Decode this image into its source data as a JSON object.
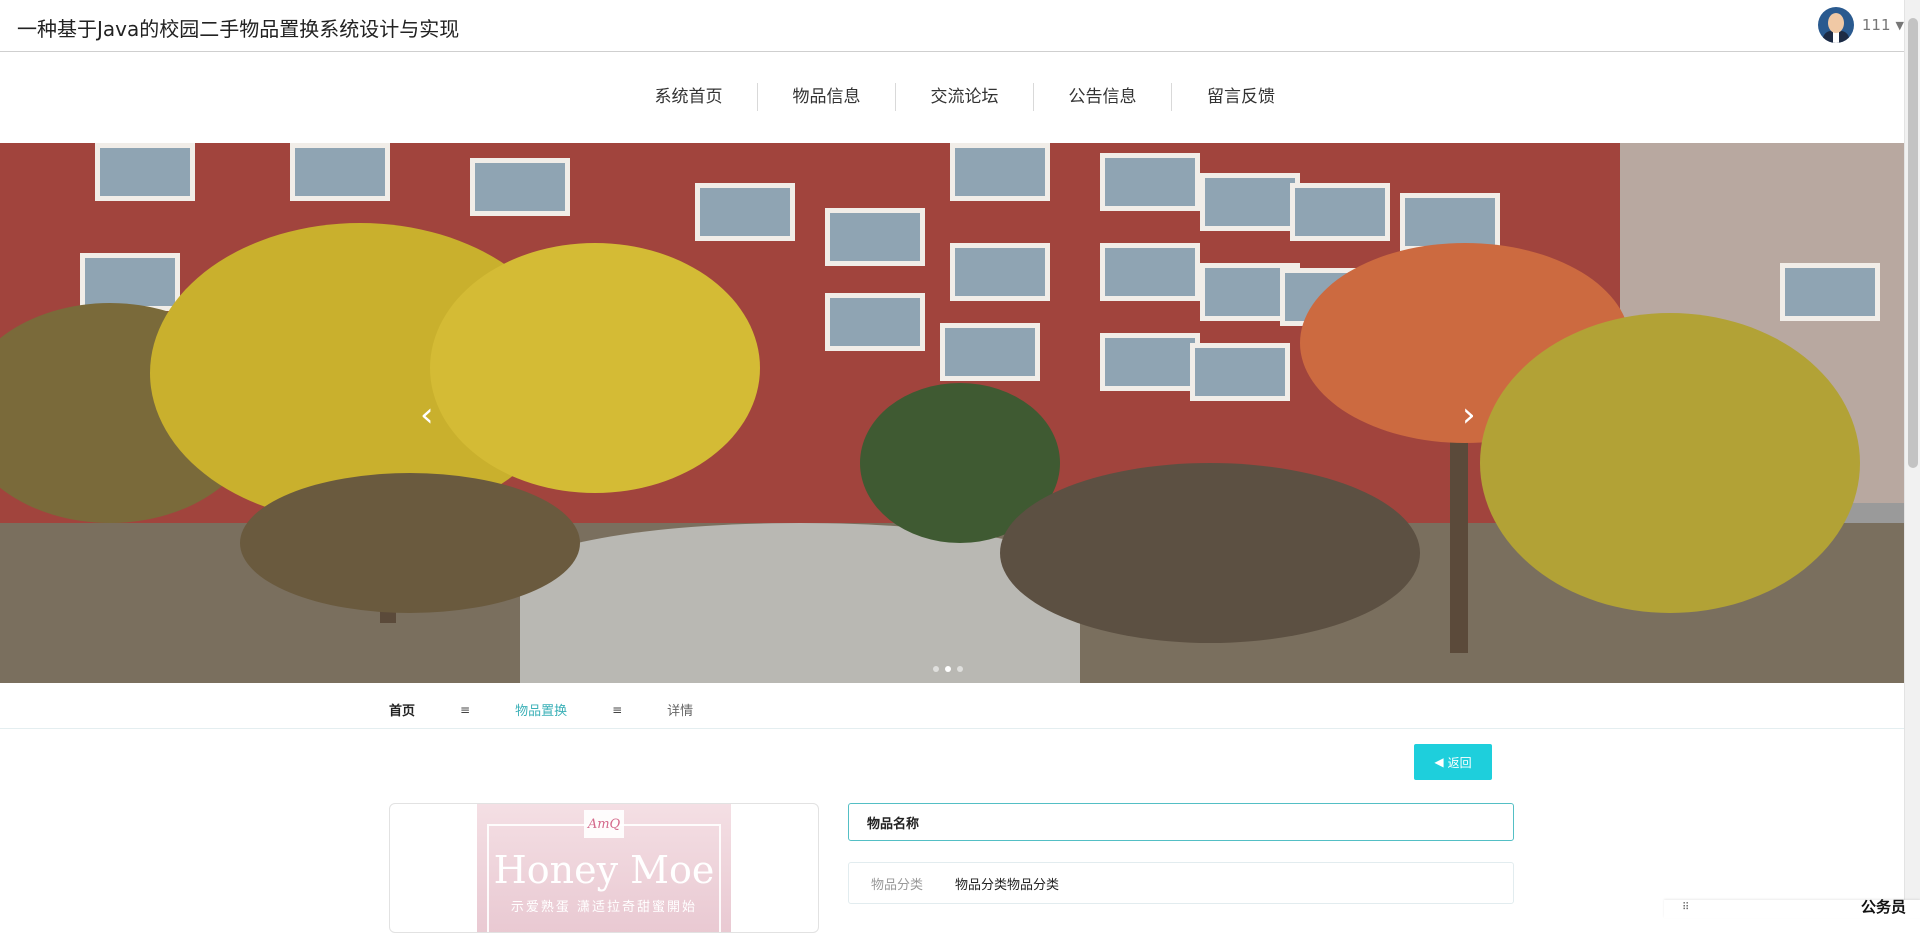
{
  "header": {
    "title": "一种基于Java的校园二手物品置换系统设计与实现",
    "username": "111"
  },
  "nav": {
    "items": [
      "系统首页",
      "物品信息",
      "交流论坛",
      "公告信息",
      "留言反馈"
    ]
  },
  "banner": {
    "prev_arrow": "‹",
    "next_arrow": "›",
    "slide_count": 3,
    "active_slide": 2
  },
  "breadcrumb": {
    "home": "首页",
    "separator": "≡",
    "section": "物品置换",
    "current": "详情"
  },
  "detail": {
    "back_label": "返回",
    "image": {
      "brand_text": "Honey Moe",
      "logo_text": "AmQ",
      "sub_text": "示爱熟蛋 潇适拉奇甜蜜開始"
    },
    "name_label": "物品名称",
    "category_label": "物品分类",
    "category_value": "物品分类物品分类"
  },
  "footer_overlay": {
    "text": "公务员"
  },
  "colors": {
    "accent": "#1ecfdc",
    "link": "#3ab0b7",
    "banner_brick": "#a1443d"
  },
  "icons": {
    "back": "caret-left-icon",
    "user_menu": "caret-down-icon"
  }
}
